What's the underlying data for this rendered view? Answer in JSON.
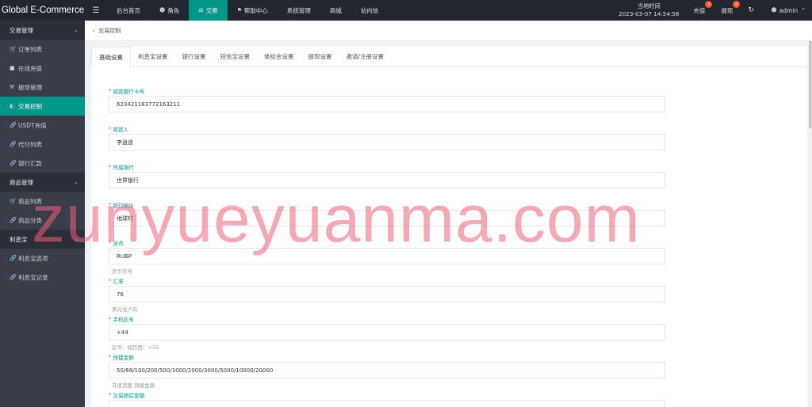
{
  "topbar": {
    "logo": "Global E-Commerce...",
    "nav": [
      {
        "label": "后台首页",
        "icon": "",
        "active": false
      },
      {
        "label": "角色",
        "icon": "user-icon",
        "active": false
      },
      {
        "label": "交易",
        "icon": "scale-icon",
        "active": true
      },
      {
        "label": "帮助中心",
        "icon": "flag-icon",
        "active": false
      },
      {
        "label": "系统管理",
        "icon": "",
        "active": false
      },
      {
        "label": "商城",
        "icon": "",
        "active": false
      },
      {
        "label": "站内信",
        "icon": "",
        "active": false
      }
    ],
    "clock_label": "当地时间",
    "clock_value": "2023-03-07 14:54:58",
    "recharge_label": "充值",
    "recharge_count": "2",
    "withdraw_label": "提现",
    "withdraw_count": "0",
    "user_name": "admin"
  },
  "sidebar": {
    "group_trade": "交易管理",
    "trade_items": [
      "订单列表",
      "在线充值",
      "提现管理",
      "交易控制",
      "USDT充值",
      "代付列表",
      "银行汇款"
    ],
    "group_goods": "商品管理",
    "goods_items": [
      "商品列表",
      "商品分类"
    ],
    "group_interest": "利息宝",
    "interest_items": [
      "利息宝选项",
      "利息宝记录"
    ]
  },
  "breadcrumb": "交易控制",
  "tabs": [
    "基础设置",
    "利息宝设置",
    "银行设置",
    "短信宝设置",
    "体验金设置",
    "提现设置",
    "邀请/注册设置"
  ],
  "form": {
    "fields": [
      {
        "label": "收款银行卡号",
        "value": "623421183772163211",
        "hint": ""
      },
      {
        "label": "收款人",
        "value": "李逍遥",
        "hint": ""
      },
      {
        "label": "所属银行",
        "value": "世界银行",
        "hint": ""
      },
      {
        "label": "银行地址",
        "value": "地球村",
        "hint": ""
      },
      {
        "label": "货币",
        "value": "RUBP",
        "hint": "货币符号"
      },
      {
        "label": "汇率",
        "value": "76",
        "hint": "美元兑卢布"
      },
      {
        "label": "手机区号",
        "value": "+44",
        "hint": "区号，如巴西：+55"
      },
      {
        "label": "快捷金额",
        "value": "50/68/100/200/500/1000/2000/3000/5000/10000/20000",
        "hint": "充值页面 快捷金额"
      },
      {
        "label": "交易赔偿金额",
        "value": "",
        "hint": ""
      }
    ]
  },
  "watermark": "zunyueyuanma.com",
  "colors": {
    "accent": "#009688",
    "topbar": "#23262e",
    "sidebar": "#393d49",
    "badge": "#ff5722"
  }
}
